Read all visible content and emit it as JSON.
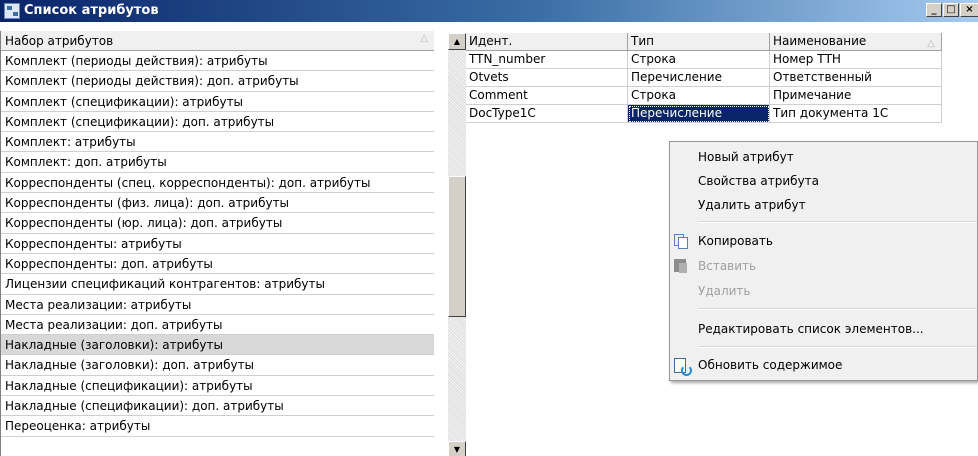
{
  "window": {
    "title": "Список атрибутов",
    "minimize_glyph": "_",
    "maximize_glyph": "□",
    "close_glyph": "×"
  },
  "left": {
    "header": "Набор атрибутов",
    "sort_glyph": "△",
    "rows": [
      "Комплект (периоды действия): атрибуты",
      "Комплект (периоды действия): доп. атрибуты",
      "Комплект (спецификации): атрибуты",
      "Комплект (спецификации): доп. атрибуты",
      "Комплект: атрибуты",
      "Комплект: доп. атрибуты",
      "Корреспонденты (спец. корреспонденты): доп. атрибуты",
      "Корреспонденты (физ. лица): доп. атрибуты",
      "Корреспонденты (юр. лица): доп. атрибуты",
      "Корреспонденты: атрибуты",
      "Корреспонденты: доп. атрибуты",
      "Лицензии спецификаций контрагентов: атрибуты",
      "Места реализации: атрибуты",
      "Места реализации: доп. атрибуты",
      "Накладные (заголовки): атрибуты",
      "Накладные (заголовки): доп. атрибуты",
      "Накладные (спецификации): атрибуты",
      "Накладные (спецификации): доп. атрибуты",
      "Переоценка: атрибуты"
    ],
    "selected_row": "Накладные (заголовки): атрибуты"
  },
  "scrollbar": {
    "up_glyph": "▲",
    "down_glyph": "▼"
  },
  "grid": {
    "headers": [
      "Идент.",
      "Тип",
      "Наименование"
    ],
    "sort_glyph": "△",
    "rows": [
      [
        "TTN_number",
        "Строка",
        "Номер ТТН"
      ],
      [
        "Otvets",
        "Перечисление",
        "Ответственный"
      ],
      [
        "Comment",
        "Строка",
        "Примечание"
      ],
      [
        "DocType1C",
        "Перечисление",
        "Тип документа 1С"
      ]
    ]
  },
  "context_menu": {
    "new_attribute": "Новый атрибут",
    "attribute_properties": "Свойства атрибута",
    "delete_attribute": "Удалить атрибут",
    "copy": "Копировать",
    "paste": "Вставить",
    "delete": "Удалить",
    "edit_element_list": "Редактировать список элементов...",
    "refresh_contents": "Обновить содержимое"
  }
}
